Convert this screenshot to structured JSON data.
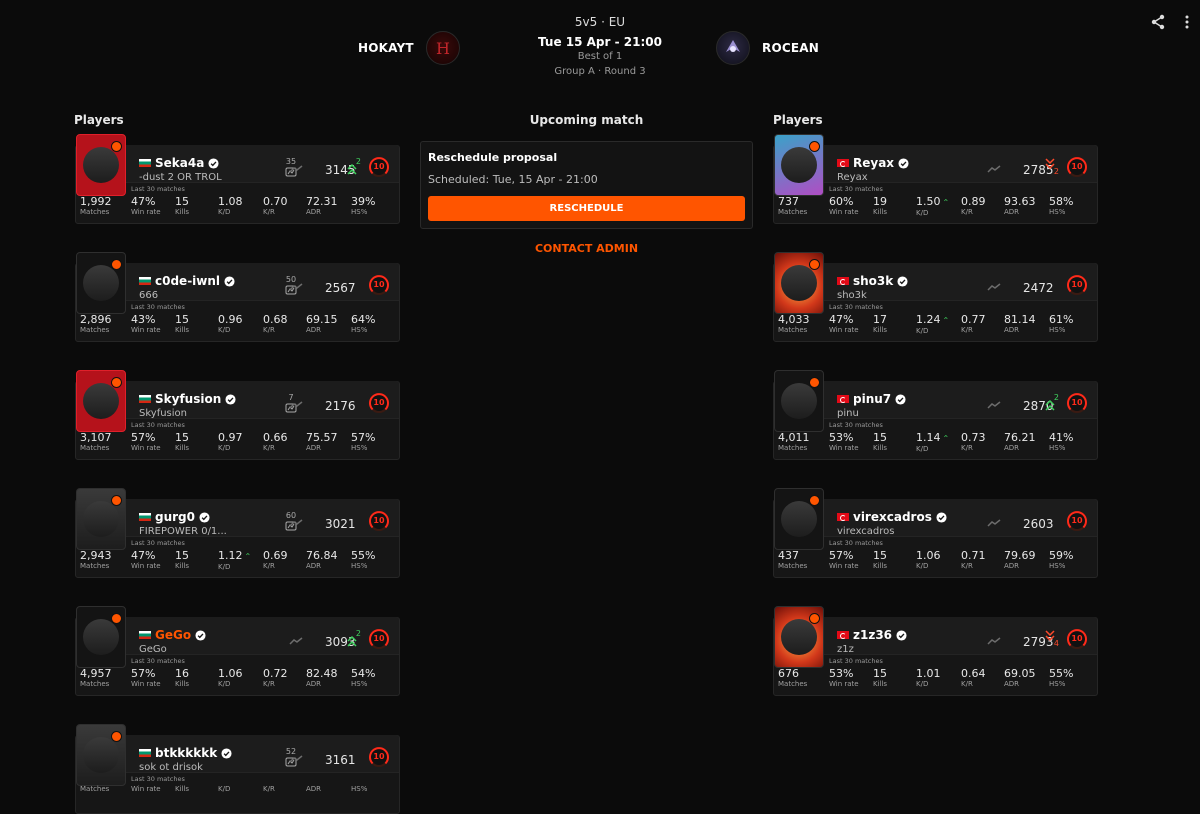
{
  "match": {
    "mode": "5v5 · EU",
    "date": "Tue 15 Apr - 21:00",
    "best_of": "Best of 1",
    "group": "Group A · Round 3",
    "team_left": "HOKAYT",
    "team_right": "ROCEAN"
  },
  "icons": {
    "share": "share-icon",
    "more": "more-vertical-icon",
    "trend": "trend-icon",
    "party": "party-icon",
    "verified": "verified-icon",
    "level": "skill-level-icon"
  },
  "colors": {
    "accent": "#ff5500",
    "background": "#0b0b0b",
    "card": "#161616",
    "up": "#3fd25e",
    "down": "#ff4a2b"
  },
  "upcoming": {
    "title": "Upcoming match",
    "proposal_title": "Reschedule proposal",
    "scheduled": "Scheduled: Tue, 15 Apr - 21:00",
    "reschedule_label": "RESCHEDULE",
    "contact_admin": "CONTACT ADMIN"
  },
  "labels": {
    "players": "Players",
    "last_30": "Last 30 matches",
    "matches": "Matches",
    "win_rate": "Win rate",
    "kills": "Kills",
    "kd": "K/D",
    "kr": "K/R",
    "adr": "ADR",
    "hs": "HS%"
  },
  "left_players": [
    {
      "name": "Seka4a",
      "nick": "-dust 2 OR TROL",
      "party": "35",
      "elo": "3145",
      "change": "2",
      "dir": "up",
      "level": "10",
      "matches": "1,992",
      "win_rate": "47%",
      "kills": "15",
      "kd": "1.08",
      "kr": "0.70",
      "adr": "72.31",
      "hs": "39%"
    },
    {
      "name": "c0de-iwnl",
      "nick": "666",
      "party": "50",
      "elo": "2567",
      "change": "",
      "dir": "",
      "level": "10",
      "matches": "2,896",
      "win_rate": "43%",
      "kills": "15",
      "kd": "0.96",
      "kr": "0.68",
      "adr": "69.15",
      "hs": "64%"
    },
    {
      "name": "Skyfusion",
      "nick": "Skyfusion",
      "party": "7",
      "elo": "2176",
      "change": "",
      "dir": "",
      "level": "10",
      "matches": "3,107",
      "win_rate": "57%",
      "kills": "15",
      "kd": "0.97",
      "kr": "0.66",
      "adr": "75.57",
      "hs": "57%"
    },
    {
      "name": "gurg0",
      "nick": "FIREPOWER 0/1...",
      "party": "60",
      "elo": "3021",
      "change": "",
      "dir": "",
      "level": "10",
      "matches": "2,943",
      "win_rate": "47%",
      "kills": "15",
      "kd": "1.12",
      "kr": "0.69",
      "adr": "76.84",
      "hs": "55%"
    },
    {
      "name": "GeGo",
      "nick": "GeGo",
      "party": "",
      "elo": "3093",
      "change": "2",
      "dir": "up",
      "level": "10",
      "matches": "4,957",
      "win_rate": "57%",
      "kills": "16",
      "kd": "1.06",
      "kr": "0.72",
      "adr": "82.48",
      "hs": "54%"
    },
    {
      "name": "btkkkkkk",
      "nick": "sok ot drisok",
      "party": "52",
      "elo": "3161",
      "change": "",
      "dir": "",
      "level": "10",
      "matches": "",
      "win_rate": "",
      "kills": "",
      "kd": "",
      "kr": "",
      "adr": "",
      "hs": ""
    }
  ],
  "right_players": [
    {
      "name": "Reyax",
      "nick": "Reyax",
      "party": "",
      "elo": "2785",
      "change": "2",
      "dir": "down",
      "level": "10",
      "matches": "737",
      "win_rate": "60%",
      "kills": "19",
      "kd": "1.50",
      "kr": "0.89",
      "adr": "93.63",
      "hs": "58%"
    },
    {
      "name": "sho3k",
      "nick": "sho3k",
      "party": "",
      "elo": "2472",
      "change": "",
      "dir": "",
      "level": "10",
      "matches": "4,033",
      "win_rate": "47%",
      "kills": "17",
      "kd": "1.24",
      "kr": "0.77",
      "adr": "81.14",
      "hs": "61%"
    },
    {
      "name": "pinu7",
      "nick": "pinu",
      "party": "",
      "elo": "2870",
      "change": "2",
      "dir": "up",
      "level": "10",
      "matches": "4,011",
      "win_rate": "53%",
      "kills": "15",
      "kd": "1.14",
      "kr": "0.73",
      "adr": "76.21",
      "hs": "41%"
    },
    {
      "name": "virexcadros",
      "nick": "virexcadros",
      "party": "",
      "elo": "2603",
      "change": "",
      "dir": "",
      "level": "10",
      "matches": "437",
      "win_rate": "57%",
      "kills": "15",
      "kd": "1.06",
      "kr": "0.71",
      "adr": "79.69",
      "hs": "59%"
    },
    {
      "name": "z1z36",
      "nick": "z1z",
      "party": "",
      "elo": "2793",
      "change": "4",
      "dir": "down",
      "level": "10",
      "matches": "676",
      "win_rate": "53%",
      "kills": "15",
      "kd": "1.01",
      "kr": "0.64",
      "adr": "69.05",
      "hs": "55%"
    }
  ]
}
